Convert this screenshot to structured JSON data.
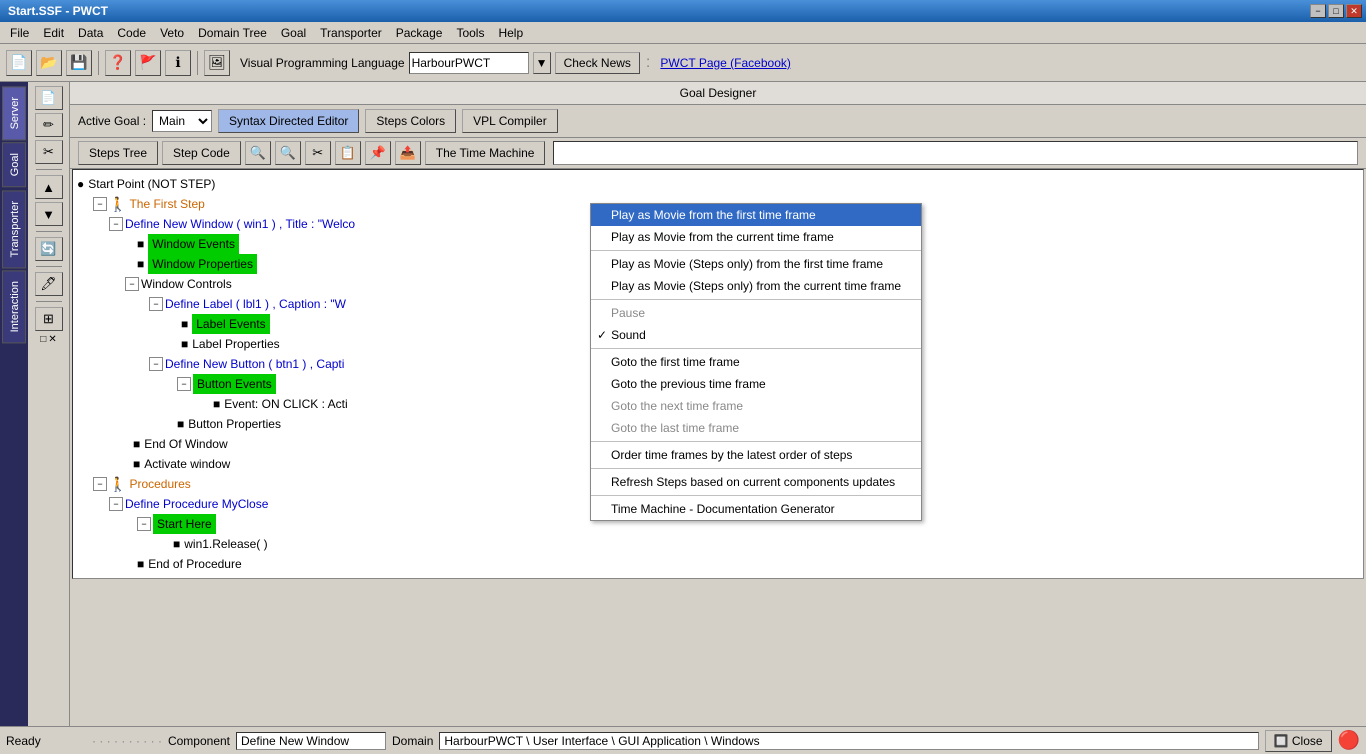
{
  "titleBar": {
    "title": "Start.SSF - PWCT",
    "minBtn": "−",
    "maxBtn": "□",
    "closeBtn": "✕"
  },
  "menuBar": {
    "items": [
      "File",
      "Edit",
      "Data",
      "Code",
      "Veto",
      "Domain Tree",
      "Goal",
      "Transporter",
      "Package",
      "Tools",
      "Help"
    ]
  },
  "toolbar": {
    "vplLabel": "Visual Programming Language",
    "vplValue": "HarbourPWCT",
    "checkNewsBtn": "Check News",
    "separator": ":",
    "pwctLink": "PWCT Page (Facebook)"
  },
  "leftSidebar": {
    "tabs": [
      "Server",
      "Goal",
      "Transporter",
      "Interaction"
    ]
  },
  "goalDesigner": {
    "header": "Goal Designer",
    "activeGoalLabel": "Active Goal :",
    "activeGoalValue": "Main",
    "syntaxBtn": "Syntax Directed Editor",
    "stepsColorsBtn": "Steps Colors",
    "vplCompilerBtn": "VPL Compiler"
  },
  "stepsToolbar": {
    "stepsTreeBtn": "Steps Tree",
    "stepCodeBtn": "Step Code",
    "timeMachineBtn": "The Time Machine"
  },
  "tree": {
    "startPoint": "Start Point (NOT STEP)",
    "firstStep": "The First Step",
    "defineNewWindow": "Define New Window  ( win1 ) , Title : \"Welco",
    "windowEvents": "Window Events",
    "windowProperties": "Window Properties",
    "windowControls": "Window Controls",
    "defineLabelCaption": "Define Label ( lbl1 ) , Caption : \"W",
    "labelEvents": "Label Events",
    "labelProperties": "Label Properties",
    "defineButton": "Define New Button ( btn1 ) , Capti",
    "buttonEvents": "Button Events",
    "eventOnClick": "Event: ON CLICK : Acti",
    "buttonProperties": "Button Properties",
    "endOfWindow": "End Of Window",
    "activateWindow": "Activate window",
    "procedures": "Procedures",
    "defineProcedure": "Define Procedure MyClose",
    "startHere": "Start Here",
    "winRelease": "win1.Release( )",
    "endOfProcedure": "End of Procedure"
  },
  "dropdownMenu": {
    "items": [
      {
        "id": "play-movie-first",
        "label": "Play as Movie from the first time frame",
        "active": true,
        "disabled": false,
        "checked": false
      },
      {
        "id": "play-movie-current",
        "label": "Play as Movie from the current time frame",
        "active": false,
        "disabled": false,
        "checked": false
      },
      {
        "id": "sep1",
        "type": "separator"
      },
      {
        "id": "play-steps-first",
        "label": "Play as Movie (Steps only) from the first time frame",
        "active": false,
        "disabled": false,
        "checked": false
      },
      {
        "id": "play-steps-current",
        "label": "Play as Movie (Steps only) from the current time frame",
        "active": false,
        "disabled": false,
        "checked": false
      },
      {
        "id": "sep2",
        "type": "separator"
      },
      {
        "id": "pause",
        "label": "Pause",
        "active": false,
        "disabled": true,
        "checked": false
      },
      {
        "id": "sound",
        "label": "Sound",
        "active": false,
        "disabled": false,
        "checked": true
      },
      {
        "id": "sep3",
        "type": "separator"
      },
      {
        "id": "goto-first",
        "label": "Goto the first time frame",
        "active": false,
        "disabled": false,
        "checked": false
      },
      {
        "id": "goto-prev",
        "label": "Goto the previous time frame",
        "active": false,
        "disabled": false,
        "checked": false
      },
      {
        "id": "goto-next",
        "label": "Goto the next time frame",
        "active": false,
        "disabled": true,
        "checked": false
      },
      {
        "id": "goto-last",
        "label": "Goto the last time frame",
        "active": false,
        "disabled": true,
        "checked": false
      },
      {
        "id": "sep4",
        "type": "separator"
      },
      {
        "id": "order-time",
        "label": "Order time frames by the latest order of steps",
        "active": false,
        "disabled": false,
        "checked": false
      },
      {
        "id": "sep5",
        "type": "separator"
      },
      {
        "id": "refresh",
        "label": "Refresh Steps based on current components updates",
        "active": false,
        "disabled": false,
        "checked": false
      },
      {
        "id": "sep6",
        "type": "separator"
      },
      {
        "id": "doc-gen",
        "label": "Time Machine - Documentation Generator",
        "active": false,
        "disabled": false,
        "checked": false
      }
    ]
  },
  "statusBar": {
    "ready": "Ready",
    "componentLabel": "Component",
    "componentValue": "Define New Window",
    "domainLabel": "Domain",
    "domainValue": "HarbourPWCT \\ User Interface \\ GUI Application \\ Windows",
    "closeBtn": "Close",
    "navDots": "· · · · · · · · · ·"
  }
}
